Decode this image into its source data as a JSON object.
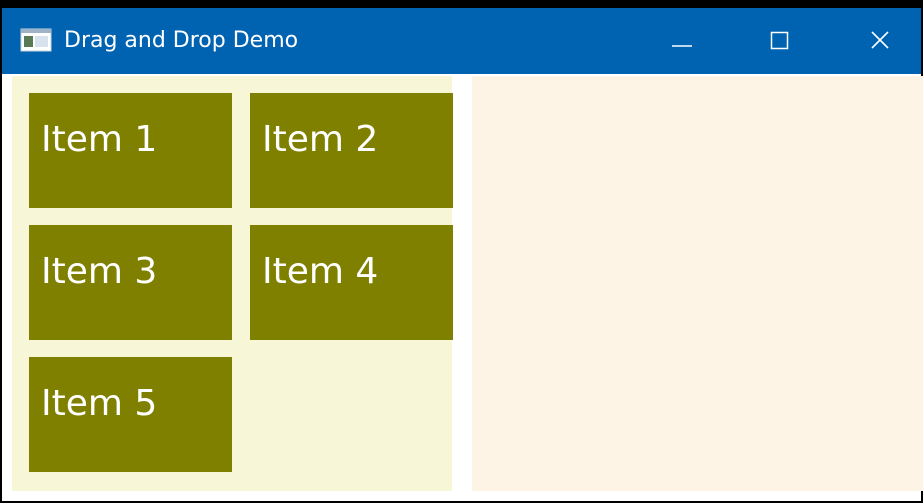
{
  "window": {
    "title": "Drag and Drop Demo",
    "icon": "app-window-icon",
    "controls": {
      "minimize": "minimize-icon",
      "maximize": "maximize-icon",
      "close": "close-icon"
    }
  },
  "source_panel": {
    "items": [
      {
        "label": "Item 1"
      },
      {
        "label": "Item 2"
      },
      {
        "label": "Item 3"
      },
      {
        "label": "Item 4"
      },
      {
        "label": "Item 5"
      }
    ]
  },
  "colors": {
    "titlebar": "#0063b1",
    "source_panel_bg": "#f7f7d7",
    "target_panel_bg": "#fdf4e6",
    "item_bg": "#808000",
    "item_text": "#ffffff"
  }
}
